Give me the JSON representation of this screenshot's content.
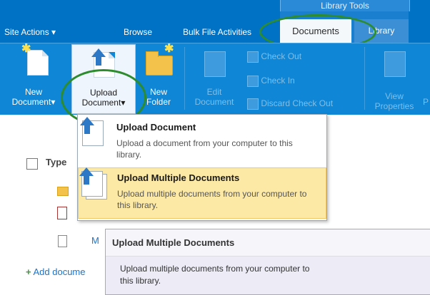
{
  "topnav": {
    "site_actions": "Site Actions",
    "site_actions_caret": "▾",
    "browse": "Browse",
    "bulk_file": "Bulk File Activities",
    "group_header": "Library Tools",
    "tab_documents": "Documents",
    "tab_library": "Library"
  },
  "ribbon": {
    "new_document": [
      "New",
      "Document"
    ],
    "upload_document": [
      "Upload",
      "Document"
    ],
    "new_folder": [
      "New",
      "Folder"
    ],
    "edit_document": [
      "Edit",
      "Document"
    ],
    "check_out": "Check Out",
    "check_in": "Check In",
    "discard_check_out": "Discard Check Out",
    "view_properties": [
      "View",
      "Properties"
    ],
    "cut_letter": "P",
    "caret": "▾"
  },
  "dropdown": {
    "items": [
      {
        "title": "Upload Document",
        "desc": "Upload a document from your computer to this library."
      },
      {
        "title": "Upload Multiple Documents",
        "desc": "Upload multiple documents from your computer to this library."
      }
    ]
  },
  "list": {
    "type_header": "Type",
    "row3_text": "M",
    "add_document": "Add docume",
    "add_plus": "+"
  },
  "tooltip": {
    "title": "Upload Multiple Documents",
    "desc": "Upload multiple documents from your computer to this library."
  },
  "colors": {
    "topbar": "#0072c6",
    "ribbon": "#0f86d6",
    "highlight": "#fde9a6",
    "annotation_oval": "#2d8c2d"
  }
}
